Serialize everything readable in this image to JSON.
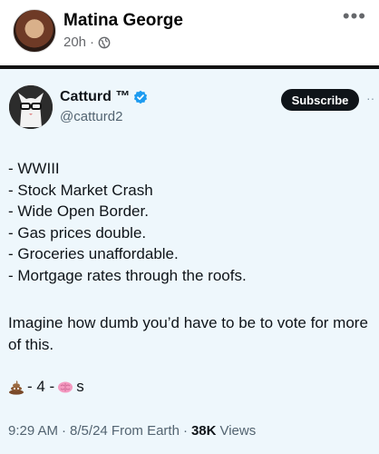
{
  "post": {
    "author": "Matina George",
    "time": "20h",
    "separator": "·",
    "more_label": "•••"
  },
  "tweet": {
    "display_name": "Catturd ™",
    "handle": "@catturd2",
    "subscribe_label": "Subscribe",
    "more_label": "··",
    "lines": [
      "- WWIII",
      "- Stock Market Crash",
      "- Wide Open Border.",
      "- Gas prices double.",
      "- Groceries unaffordable.",
      "- Mortgage rates through the roofs."
    ],
    "paragraph": "Imagine how dumb you’d have to be to vote for more of this.",
    "emoji_line": {
      "part1": "- 4 -",
      "part2": "s"
    },
    "footer": {
      "time": "9:29 AM",
      "dot1": "·",
      "date_source": "8/5/24 From Earth",
      "dot2": "·",
      "views_count": "38K",
      "views_label": "Views"
    }
  },
  "colors": {
    "verified": "#1d9bf0",
    "tweet_bg": "#eef7fc"
  }
}
